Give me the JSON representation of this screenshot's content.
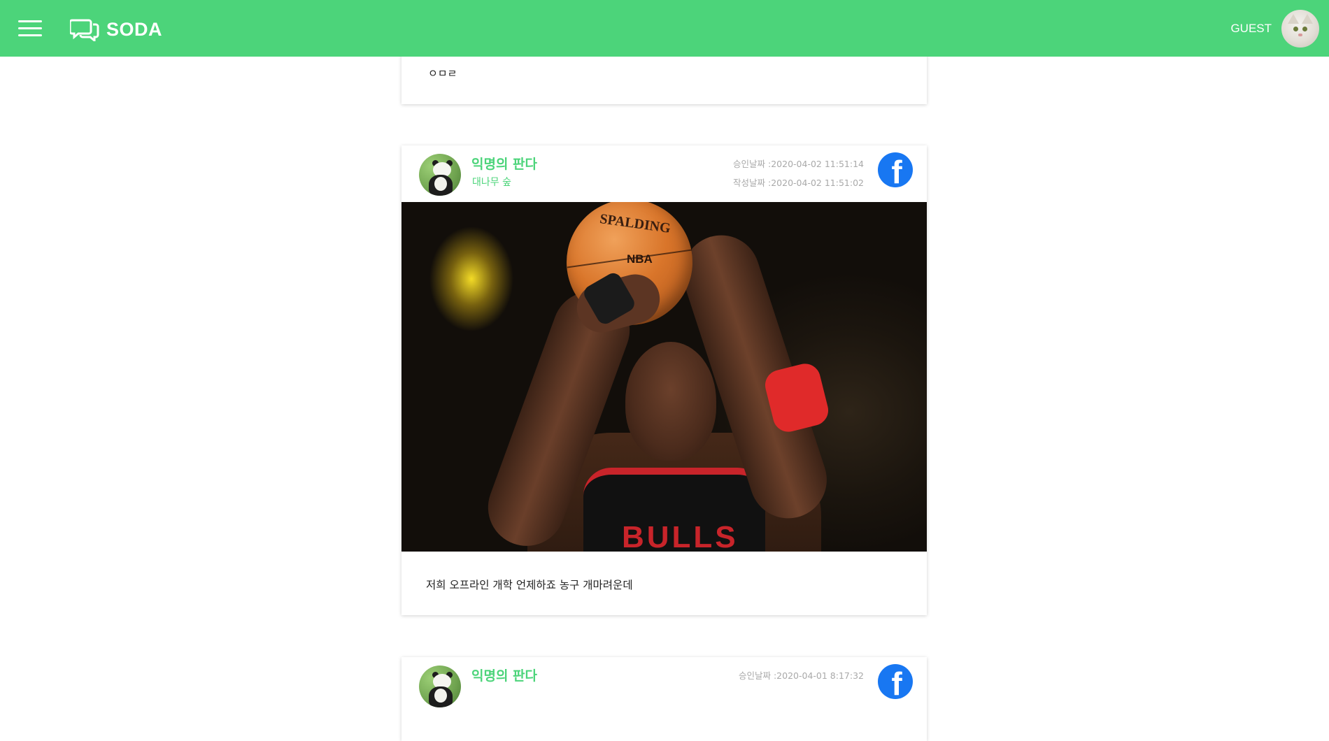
{
  "header": {
    "app_name": "SODA",
    "user_name": "GUEST",
    "brand_color": "#4cd47a",
    "menu_icon": "hamburger-icon",
    "logo_icon": "chat-bubbles-icon"
  },
  "previous_post": {
    "body": "ㅇㅁㄹ"
  },
  "posts": [
    {
      "author": "익명의 판다",
      "board": "대나무 숲",
      "approved_label": "승인날짜 :2020-04-02 11:51:14",
      "written_label": "작성날짜 :2020-04-02 11:51:02",
      "share_icon": "facebook-icon",
      "image_alt": "basketball player shooting free throw",
      "ball_brand": "SPALDING",
      "ball_league": "NBA",
      "jersey_text": "BULLS",
      "body": "저희 오프라인 개학 언제하죠 농구 개마려운데"
    },
    {
      "author": "익명의 판다",
      "approved_label": "승인날짜 :2020-04-01 8:17:32",
      "share_icon": "facebook-icon"
    }
  ]
}
